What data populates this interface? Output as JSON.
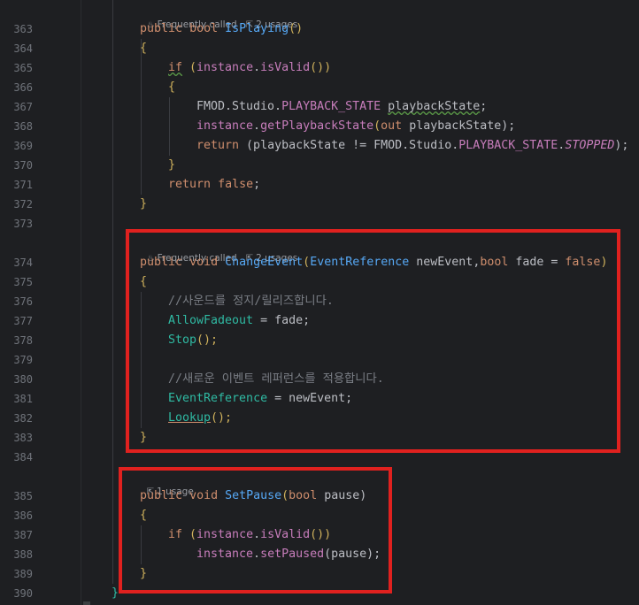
{
  "hints": {
    "is_playing": {
      "frequent": "Frequently called",
      "usages": "2 usages"
    },
    "change_event": {
      "frequent": "Frequently called",
      "usages": "2 usages"
    },
    "set_pause": {
      "usages": "1 usage"
    }
  },
  "line_numbers": [
    "363",
    "364",
    "365",
    "366",
    "367",
    "368",
    "369",
    "370",
    "371",
    "372",
    "373",
    "374",
    "375",
    "376",
    "377",
    "378",
    "379",
    "380",
    "381",
    "382",
    "383",
    "384",
    "385",
    "386",
    "387",
    "388",
    "389",
    "390"
  ],
  "code": {
    "l363": {
      "kw1": "public",
      "kw2": "bool",
      "fn": "IsPlaying",
      "p": "()"
    },
    "l364": {
      "t": "{"
    },
    "l365": {
      "kw": "if",
      "p1": " (",
      "v": "instance",
      "d": ".",
      "m": "isValid",
      "p2": "())"
    },
    "l366": {
      "t": "{"
    },
    "l367": {
      "a": "FMOD.Studio.",
      "b": "PLAYBACK_STATE",
      "c": " ",
      "d": "playbackState",
      "e": ";"
    },
    "l368": {
      "a": "instance",
      "b": ".",
      "c": "getPlaybackState",
      "d": "(",
      "e": "out",
      "f": " playbackState);"
    },
    "l369": {
      "kw": "return",
      "a": " (playbackState != FMOD.Studio.",
      "b": "PLAYBACK_STATE",
      "c": ".",
      "d": "STOPPED",
      "e": ");"
    },
    "l370": {
      "t": "}"
    },
    "l371": {
      "kw": "return",
      "v": "false",
      "e": ";"
    },
    "l372": {
      "t": "}"
    },
    "l374": {
      "kw1": "public",
      "kw2": "void",
      "fn": "ChangeEvent",
      "p": "(",
      "ty": "EventReference",
      "a": " newEvent,",
      "kw3": "bool",
      "b": " fade = ",
      "kw4": "false",
      "c": ")"
    },
    "l375": {
      "t": "{"
    },
    "l376": {
      "t": "//사운드를 정지/릴리즈합니다."
    },
    "l377": {
      "a": "AllowFadeout",
      "b": " = fade;"
    },
    "l378": {
      "a": "Stop",
      "b": "();"
    },
    "l380": {
      "t": "//새로운 이벤트 레퍼런스를 적용합니다."
    },
    "l381": {
      "a": "EventReference",
      "b": " = newEvent;"
    },
    "l382": {
      "a": "Lookup",
      "b": "();"
    },
    "l383": {
      "t": "}"
    },
    "l385": {
      "kw1": "public",
      "kw2": "void",
      "fn": "SetPause",
      "p": "(",
      "kw3": "bool",
      "a": " pause)"
    },
    "l386": {
      "t": "{"
    },
    "l387": {
      "kw": "if",
      "p1": " (",
      "v": "instance",
      "d": ".",
      "m": "isValid",
      "p2": "())"
    },
    "l388": {
      "a": "instance",
      "b": ".",
      "c": "setPaused",
      "d": "(pause);"
    },
    "l389": {
      "t": "}"
    },
    "l390": {
      "t": "}"
    }
  },
  "colors": {
    "highlight_box": "#e0211f",
    "keyword": "#cf8e6d",
    "method": "#56a8f5",
    "member": "#c77dbb",
    "comment": "#7a7e85"
  }
}
